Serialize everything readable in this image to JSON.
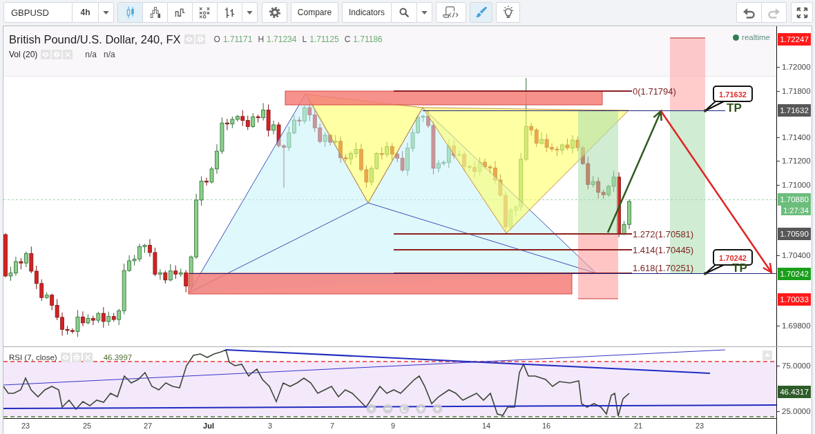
{
  "toolbar": {
    "symbol": {
      "value": "GBPUSD"
    },
    "interval": {
      "label": "4h"
    },
    "chart_types": [
      {
        "kind": "candles",
        "selected": true
      },
      {
        "kind": "blocks",
        "selected": false
      },
      {
        "kind": "line_break",
        "selected": false
      },
      {
        "kind": "point_figure",
        "selected": false
      },
      {
        "kind": "bars",
        "selected": false
      }
    ],
    "compare": {
      "label": "Compare"
    },
    "indicators": {
      "label": "Indicators"
    },
    "tools": [
      {
        "kind": "script",
        "selected": false
      },
      {
        "kind": "brush",
        "selected": true
      },
      {
        "kind": "idea",
        "selected": false
      }
    ],
    "history": [
      {
        "kind": "undo",
        "disabled": false
      },
      {
        "kind": "redo",
        "disabled": true
      }
    ]
  },
  "chart": {
    "title": "British Pound/U.S. Dollar, 240, FX",
    "ohlc": [
      {
        "label": "O",
        "value": "1.71171"
      },
      {
        "label": "H",
        "value": "1.71234"
      },
      {
        "label": "L",
        "value": "1.71125"
      },
      {
        "label": "C",
        "value": "1.71186"
      }
    ],
    "volume": {
      "label": "Vol (20)",
      "values": [
        "n/a",
        "n/a"
      ]
    },
    "status": "realtime",
    "fib_levels": [
      "0(1.71794)",
      "1.272(1.70581)",
      "1.414(1.70445)",
      "1.618(1.70251)"
    ],
    "callouts": [
      {
        "value": "1.71632",
        "tag": "TP"
      },
      {
        "value": "1.70242",
        "tag": "TP"
      }
    ]
  },
  "price_axis": {
    "ticks": [
      "1.72000",
      "1.71800",
      "1.71400",
      "1.71200",
      "1.71000",
      "1.70400",
      "1.69800"
    ],
    "tags": [
      {
        "kind": "price",
        "text": "1.72247",
        "color": "#ff1a1a"
      },
      {
        "kind": "price",
        "text": "1.71632",
        "color": "#575757"
      },
      {
        "kind": "price",
        "text": "1.70880",
        "color": "#6cbd7c"
      },
      {
        "kind": "countdown",
        "text": "1:27:34",
        "color": "#6cbd7c"
      },
      {
        "kind": "price",
        "text": "1.70590",
        "color": "#575757"
      },
      {
        "kind": "price",
        "text": "1.70242",
        "color": "#1a9f1a"
      },
      {
        "kind": "price",
        "text": "1.70033",
        "color": "#ff1a1a"
      }
    ]
  },
  "rsi": {
    "title": "RSI (7, close)",
    "value": "46.3997",
    "ticks": [
      "75.0000",
      "25.0000"
    ],
    "tag": "46.4317"
  },
  "time_axis": [
    {
      "kind": "day",
      "label": "23"
    },
    {
      "kind": "day",
      "label": "25"
    },
    {
      "kind": "day",
      "label": "27"
    },
    {
      "kind": "month",
      "label": "Jul"
    },
    {
      "kind": "day",
      "label": "3"
    },
    {
      "kind": "day",
      "label": "7"
    },
    {
      "kind": "day",
      "label": "9"
    },
    {
      "kind": "day",
      "label": "14"
    },
    {
      "kind": "day",
      "label": "16"
    },
    {
      "kind": "day",
      "label": "21"
    },
    {
      "kind": "day",
      "label": "23"
    }
  ]
}
